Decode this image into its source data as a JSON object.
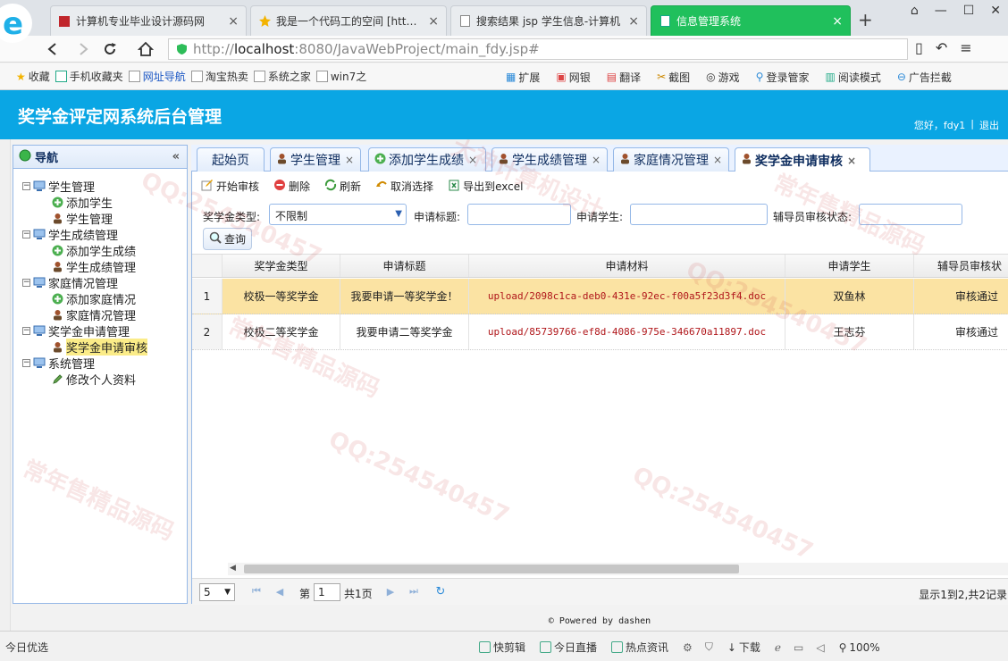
{
  "browser": {
    "tabs": [
      {
        "title": "计算机专业毕业设计源码网"
      },
      {
        "title": "我是一个代码工的空间 [http://"
      },
      {
        "title": "搜索结果 jsp 学生信息-计算机"
      },
      {
        "title": "信息管理系统"
      }
    ],
    "url_scheme": "http://",
    "url_host": "localhost",
    "url_rest": ":8080/JavaWebProject/main_fdy.jsp#",
    "bookmarks": [
      "收藏",
      "手机收藏夹",
      "网址导航",
      "淘宝热卖",
      "系统之家",
      "win7之"
    ],
    "bookmarks_right": [
      "扩展",
      "网银",
      "翻译",
      "截图",
      "游戏",
      "登录管家",
      "阅读模式",
      "广告拦截"
    ]
  },
  "header": {
    "title": "奖学金评定网系统后台管理",
    "greeting": "您好，fdy1",
    "separator": "|",
    "logout": "退出"
  },
  "sidebar": {
    "title": "导航",
    "tree": [
      {
        "label": "学生管理",
        "children": [
          "添加学生",
          "学生管理"
        ]
      },
      {
        "label": "学生成绩管理",
        "children": [
          "添加学生成绩",
          "学生成绩管理"
        ]
      },
      {
        "label": "家庭情况管理",
        "children": [
          "添加家庭情况",
          "家庭情况管理"
        ]
      },
      {
        "label": "奖学金申请管理",
        "children": [
          "奖学金申请审核"
        ]
      },
      {
        "label": "系统管理",
        "children": [
          "修改个人资料"
        ]
      }
    ]
  },
  "content_tabs": [
    {
      "label": "起始页"
    },
    {
      "label": "学生管理"
    },
    {
      "label": "添加学生成绩"
    },
    {
      "label": "学生成绩管理"
    },
    {
      "label": "家庭情况管理"
    },
    {
      "label": "奖学金申请审核"
    }
  ],
  "toolbar": [
    "开始审核",
    "删除",
    "刷新",
    "取消选择",
    "导出到excel"
  ],
  "filters": {
    "type_label": "奖学金类型:",
    "type_value": "不限制",
    "title_label": "申请标题:",
    "student_label": "申请学生:",
    "status_label": "辅导员审核状态:",
    "query": "查询"
  },
  "table": {
    "columns": [
      "奖学金类型",
      "申请标题",
      "申请材料",
      "申请学生",
      "辅导员审核状"
    ],
    "rows": [
      {
        "num": "1",
        "cells": [
          "校极一等奖学金",
          "我要申请一等奖学金！",
          "upload/2098c1ca-deb0-431e-92ec-f00a5f23d3f4.doc",
          "双鱼林",
          "审核通过"
        ]
      },
      {
        "num": "2",
        "cells": [
          "校极二等奖学金",
          "我要申请二等奖学金",
          "upload/85739766-ef8d-4086-975e-346670a11897.doc",
          "王志芬",
          "审核通过"
        ]
      }
    ]
  },
  "pager": {
    "page_size": "5",
    "page_prefix": "第",
    "page_value": "1",
    "page_total": "共1页",
    "info": "显示1到2,共2记录"
  },
  "footer": "© Powered by dashen",
  "statusbar": {
    "left": "今日优选",
    "items": [
      "快剪辑",
      "今日直播",
      "热点资讯"
    ],
    "download": "下载",
    "zoom": "100%"
  },
  "watermarks": [
    "常年售精品源码",
    "QQ:254540457",
    "大神计算机设计"
  ]
}
